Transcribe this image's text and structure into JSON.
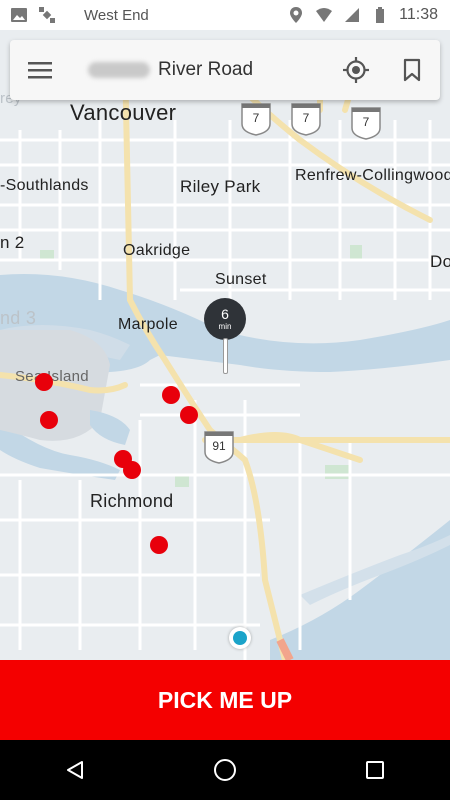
{
  "status_bar": {
    "carrier": "West End",
    "time": "11:38",
    "icons": [
      "gallery-icon",
      "satellite-icon",
      "location-icon",
      "wifi-icon",
      "signal-icon",
      "battery-icon"
    ]
  },
  "search_bar": {
    "menu_icon": "hamburger-menu-icon",
    "address": "River Road",
    "locate_icon": "crosshair-locate-icon",
    "bookmark_icon": "bookmark-icon"
  },
  "map": {
    "labels": {
      "vancouver": "Vancouver",
      "southlands": "-Southlands",
      "riley_park": "Riley Park",
      "renfrew": "Renfrew-Collingwood",
      "oakridge": "Oakridge",
      "sunset": "Sunset",
      "marpole": "Marpole",
      "sea_island": "Sea Island",
      "richmond": "Richmond",
      "do": "Do",
      "n2": "n 2",
      "nd3": "nd 3",
      "rey": "rey"
    },
    "highway_shields": [
      "7",
      "7",
      "7",
      "91"
    ],
    "eta_pin": {
      "value": "6",
      "unit": "min"
    }
  },
  "pickup_button": {
    "label": "PICK ME UP"
  },
  "nav_bar": {
    "back_icon": "back-triangle-icon",
    "home_icon": "home-circle-icon",
    "recents_icon": "recents-square-icon"
  }
}
